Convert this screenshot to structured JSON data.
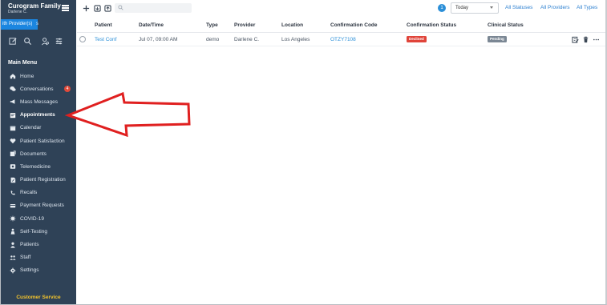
{
  "sidebar": {
    "org_name": "Curogram Family ...",
    "org_user": "Darlene C.",
    "provider_badge": "ith Provider(s)",
    "provider_tail": "s",
    "main_menu_label": "Main Menu",
    "items": [
      {
        "label": "Home",
        "icon": "home-icon"
      },
      {
        "label": "Conversations",
        "icon": "chat-icon",
        "badge": "4"
      },
      {
        "label": "Mass Messages",
        "icon": "megaphone-icon"
      },
      {
        "label": "Appointments",
        "icon": "appointments-icon",
        "active": true
      },
      {
        "label": "Calendar",
        "icon": "calendar-icon"
      },
      {
        "label": "Patient Satisfaction",
        "icon": "heart-icon"
      },
      {
        "label": "Documents",
        "icon": "documents-icon"
      },
      {
        "label": "Telemedicine",
        "icon": "telemedicine-icon"
      },
      {
        "label": "Patient Registration",
        "icon": "registration-icon"
      },
      {
        "label": "Recalls",
        "icon": "recalls-icon"
      },
      {
        "label": "Payment Requests",
        "icon": "payment-icon"
      },
      {
        "label": "COVID-19",
        "icon": "virus-icon"
      },
      {
        "label": "Self-Testing",
        "icon": "self-testing-icon"
      },
      {
        "label": "Patients",
        "icon": "patients-icon"
      },
      {
        "label": "Staff",
        "icon": "staff-icon"
      },
      {
        "label": "Settings",
        "icon": "gear-icon"
      }
    ],
    "customer_service": "Customer Service"
  },
  "toolbar": {
    "filter_count": "1",
    "date_filter": "Today",
    "statuses_link": "All Statuses",
    "providers_link": "All Providers",
    "types_link": "All Types"
  },
  "table": {
    "headers": {
      "patient": "Patient",
      "datetime": "Date/Time",
      "type": "Type",
      "provider": "Provider",
      "location": "Location",
      "confirmation_code": "Confirmation Code",
      "confirmation_status": "Confirmation Status",
      "clinical_status": "Clinical Status"
    },
    "rows": [
      {
        "patient": "Test Conf",
        "datetime": "Jul 07, 09:00 AM",
        "type": "demo",
        "provider": "Darlene C.",
        "location": "Los Angeles",
        "confirmation_code": "OTZY7108",
        "confirmation_status": "Declined",
        "clinical_status": "Pending"
      }
    ]
  },
  "colors": {
    "sidebar_bg": "#2f4257",
    "accent": "#2b8fd8",
    "declined": "#e0443a",
    "pending": "#7b8794",
    "arrow": "#e02020"
  }
}
